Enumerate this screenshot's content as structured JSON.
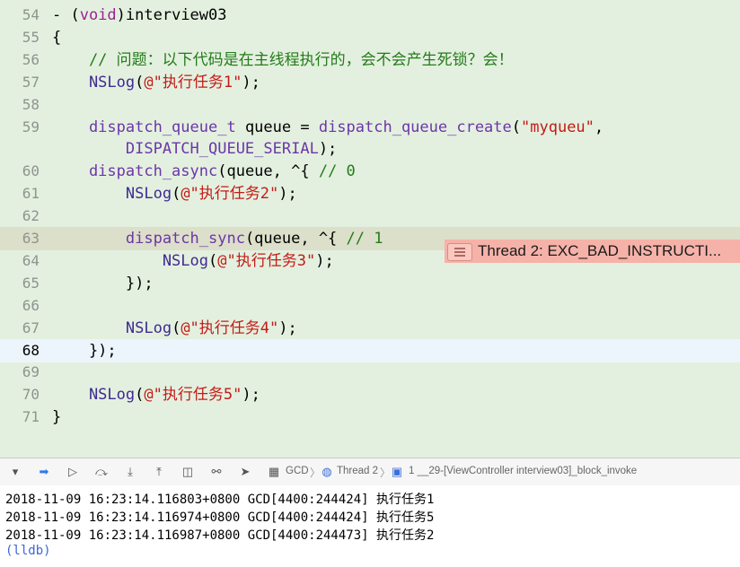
{
  "editor": {
    "lines": [
      {
        "num": "54",
        "parts": [
          [
            "",
            "- ("
          ],
          [
            "kw",
            "void"
          ],
          [
            "",
            ")interview03"
          ]
        ]
      },
      {
        "num": "55",
        "parts": [
          [
            "",
            "{"
          ]
        ]
      },
      {
        "num": "56",
        "parts": [
          [
            "cm",
            "    // 问题：以下代码是在主线程执行的，会不会产生死锁？会！"
          ]
        ]
      },
      {
        "num": "57",
        "parts": [
          [
            "fn",
            "    NSLog"
          ],
          [
            "",
            "("
          ],
          [
            "str",
            "@\"执行任务1\""
          ],
          [
            "",
            ");"
          ]
        ]
      },
      {
        "num": "58",
        "parts": []
      },
      {
        "num": "59",
        "parts": [
          [
            "fnp",
            "    dispatch_queue_t"
          ],
          [
            "",
            " queue = "
          ],
          [
            "fnp",
            "dispatch_queue_create"
          ],
          [
            "",
            "("
          ],
          [
            "str",
            "\"myqueu\""
          ],
          [
            "",
            ","
          ]
        ]
      },
      {
        "num": "",
        "parts": [
          [
            "fnp",
            "        DISPATCH_QUEUE_SERIAL"
          ],
          [
            "",
            ");"
          ]
        ]
      },
      {
        "num": "60",
        "parts": [
          [
            "fnp",
            "    dispatch_async"
          ],
          [
            "",
            "(queue, ^{ "
          ],
          [
            "cm",
            "// 0"
          ]
        ]
      },
      {
        "num": "61",
        "parts": [
          [
            "fn",
            "        NSLog"
          ],
          [
            "",
            "("
          ],
          [
            "str",
            "@\"执行任务2\""
          ],
          [
            "",
            ");"
          ]
        ]
      },
      {
        "num": "62",
        "parts": []
      },
      {
        "num": "63",
        "parts": [
          [
            "fnp",
            "        dispatch_sync"
          ],
          [
            "",
            "(queue, ^{ "
          ],
          [
            "cm",
            "// 1"
          ]
        ]
      },
      {
        "num": "64",
        "parts": [
          [
            "fn",
            "            NSLog"
          ],
          [
            "",
            "("
          ],
          [
            "str",
            "@\"执行任务3\""
          ],
          [
            "",
            ");"
          ]
        ]
      },
      {
        "num": "65",
        "parts": [
          [
            "",
            "        });"
          ]
        ]
      },
      {
        "num": "66",
        "parts": []
      },
      {
        "num": "67",
        "parts": [
          [
            "fn",
            "        NSLog"
          ],
          [
            "",
            "("
          ],
          [
            "str",
            "@\"执行任务4\""
          ],
          [
            "",
            ");"
          ]
        ]
      },
      {
        "num": "68",
        "parts": [
          [
            "",
            "    });"
          ]
        ]
      },
      {
        "num": "69",
        "parts": []
      },
      {
        "num": "70",
        "parts": [
          [
            "fn",
            "    NSLog"
          ],
          [
            "",
            "("
          ],
          [
            "str",
            "@\"执行任务5\""
          ],
          [
            "",
            ");"
          ]
        ]
      },
      {
        "num": "71",
        "parts": [
          [
            "",
            "}"
          ]
        ]
      }
    ],
    "error_line_index": 10,
    "current_line_index": 15,
    "error_message": "Thread 2: EXC_BAD_INSTRUCTI..."
  },
  "debugbar": {
    "crumbs": {
      "project": "GCD",
      "thread": "Thread 2",
      "frame": "1 __29-[ViewController interview03]_block_invoke"
    }
  },
  "console": {
    "lines": [
      "2018-11-09 16:23:14.116803+0800 GCD[4400:244424] 执行任务1",
      "2018-11-09 16:23:14.116974+0800 GCD[4400:244424] 执行任务5",
      "2018-11-09 16:23:14.116987+0800 GCD[4400:244473] 执行任务2"
    ],
    "prompt": "(lldb)"
  },
  "colors": {
    "editor_bg": "#e3f0df",
    "error_bg": "#f6b2a8",
    "keyword": "#9b2393",
    "string": "#c41a16",
    "comment": "#237b19"
  }
}
